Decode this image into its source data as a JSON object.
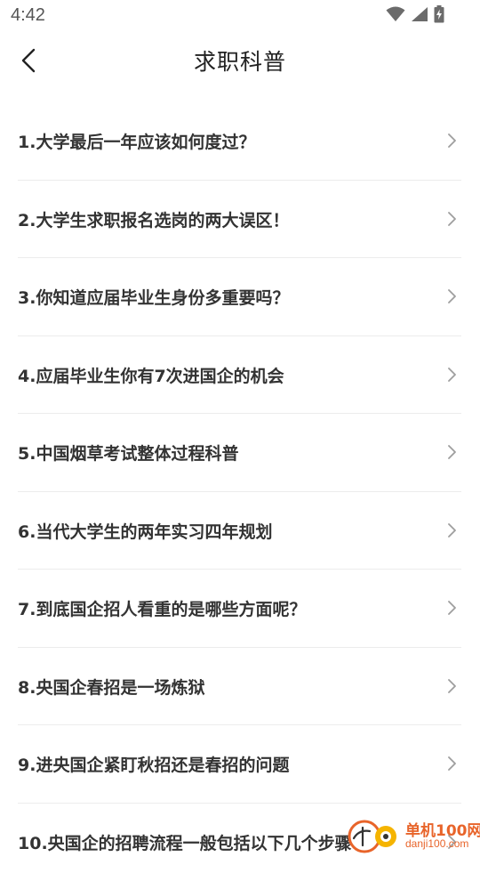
{
  "status_bar": {
    "time": "4:42",
    "icons": [
      "wifi-icon",
      "cellular-signal-icon",
      "battery-charging-icon"
    ]
  },
  "nav": {
    "back_icon": "chevron-left-icon",
    "title": "求职科普"
  },
  "list": {
    "items": [
      {
        "label": "1.大学最后一年应该如何度过？"
      },
      {
        "label": "2.大学生求职报名选岗的两大误区！"
      },
      {
        "label": "3.你知道应届毕业生身份多重要吗？"
      },
      {
        "label": "4.应届毕业生你有7次进国企的机会"
      },
      {
        "label": "5.中国烟草考试整体过程科普"
      },
      {
        "label": "6.当代大学生的两年实习四年规划"
      },
      {
        "label": "7.到底国企招人看重的是哪些方面呢？"
      },
      {
        "label": "8.央国企春招是一场炼狱"
      },
      {
        "label": "9.进央国企紧盯秋招还是春招的问题"
      },
      {
        "label": "10.央国企的招聘流程一般包括以下几个步骤"
      }
    ],
    "chevron_icon": "chevron-right-icon"
  },
  "watermark": {
    "title": "单机100网",
    "url": "danji100.com",
    "accent_color": "#e8642a"
  },
  "colors": {
    "background": "#ffffff",
    "text": "#333333",
    "divider": "#ececec",
    "chevron": "#9e9e9e"
  }
}
